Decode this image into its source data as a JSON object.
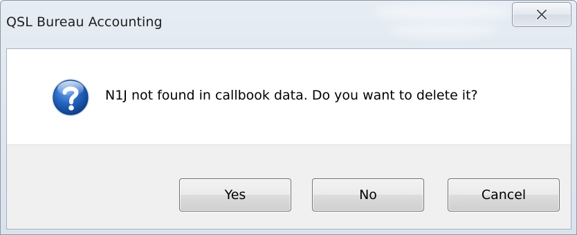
{
  "window": {
    "title": "QSL Bureau Accounting",
    "close_icon": "close-x-icon"
  },
  "message": {
    "icon": "question-icon",
    "text": "N1J not found in callbook data.  Do you want to delete it?"
  },
  "buttons": {
    "yes_label": "Yes",
    "no_label": "No",
    "cancel_label": "Cancel"
  },
  "colors": {
    "frame": "#dfe7f0",
    "button_bar": "#f0f0f0",
    "icon_blue": "#1f5fb3"
  }
}
